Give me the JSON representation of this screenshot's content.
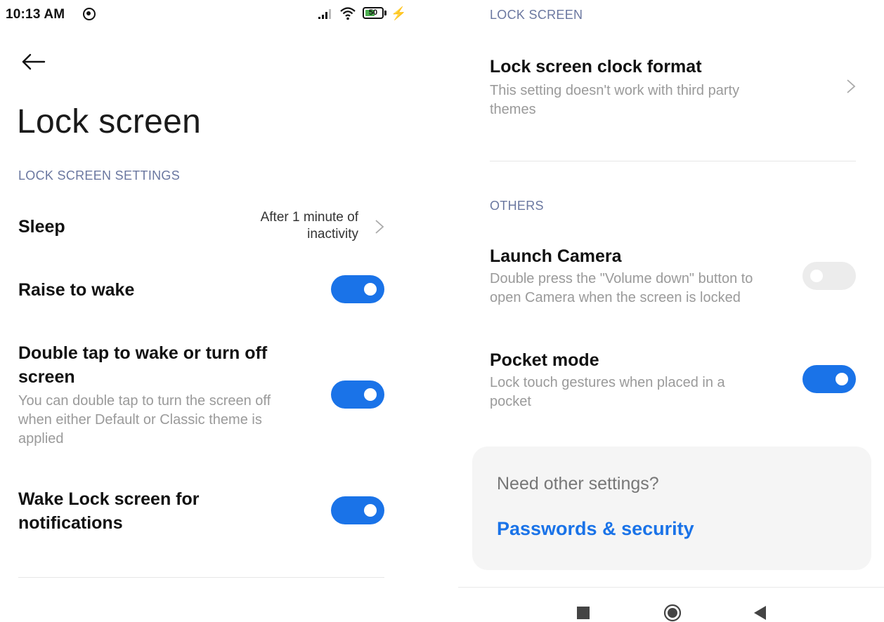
{
  "status_bar": {
    "time": "10:13 AM",
    "battery_level": "50",
    "icons": [
      "sync-icon",
      "signal-icon",
      "wifi-icon",
      "battery-icon",
      "charging-bolt-icon"
    ]
  },
  "header": {
    "back_icon": "arrow-left-icon",
    "title": "Lock screen"
  },
  "left_section": {
    "label": "LOCK SCREEN SETTINGS",
    "items": [
      {
        "title": "Sleep",
        "value_line1": "After 1 minute of",
        "value_line2": "inactivity"
      },
      {
        "title": "Raise to wake",
        "toggle": "on"
      },
      {
        "title_line1": "Double tap to wake or turn off",
        "title_line2": "screen",
        "desc_line1": "You can double tap to turn the screen off",
        "desc_line2": "when either Default or Classic theme is",
        "desc_line3": "applied",
        "toggle": "on"
      },
      {
        "title_line1": "Wake Lock screen for",
        "title_line2": "notifications",
        "toggle": "on"
      }
    ]
  },
  "right_section": {
    "lock_screen_label": "LOCK SCREEN",
    "clock_format": {
      "title": "Lock screen clock format",
      "desc_line1": "This setting doesn't work with third party",
      "desc_line2": "themes"
    },
    "others_label": "OTHERS",
    "launch_camera": {
      "title": "Launch Camera",
      "desc_line1": "Double press the \"Volume down\" button to",
      "desc_line2": "open Camera when the screen is locked",
      "toggle": "off"
    },
    "pocket_mode": {
      "title": "Pocket mode",
      "desc_line1": "Lock touch gestures when placed in a",
      "desc_line2": "pocket",
      "toggle": "on"
    }
  },
  "card": {
    "title": "Need other settings?",
    "link": "Passwords & security"
  },
  "nav_bar": {
    "icons": [
      "recents-square-icon",
      "home-circle-icon",
      "back-triangle-icon"
    ]
  },
  "colors": {
    "accent": "#1a73e8",
    "section_label": "#6a77a0",
    "secondary_text": "#9a9a9a",
    "toggle_off": "#ececec",
    "card_bg": "#f5f5f5"
  }
}
